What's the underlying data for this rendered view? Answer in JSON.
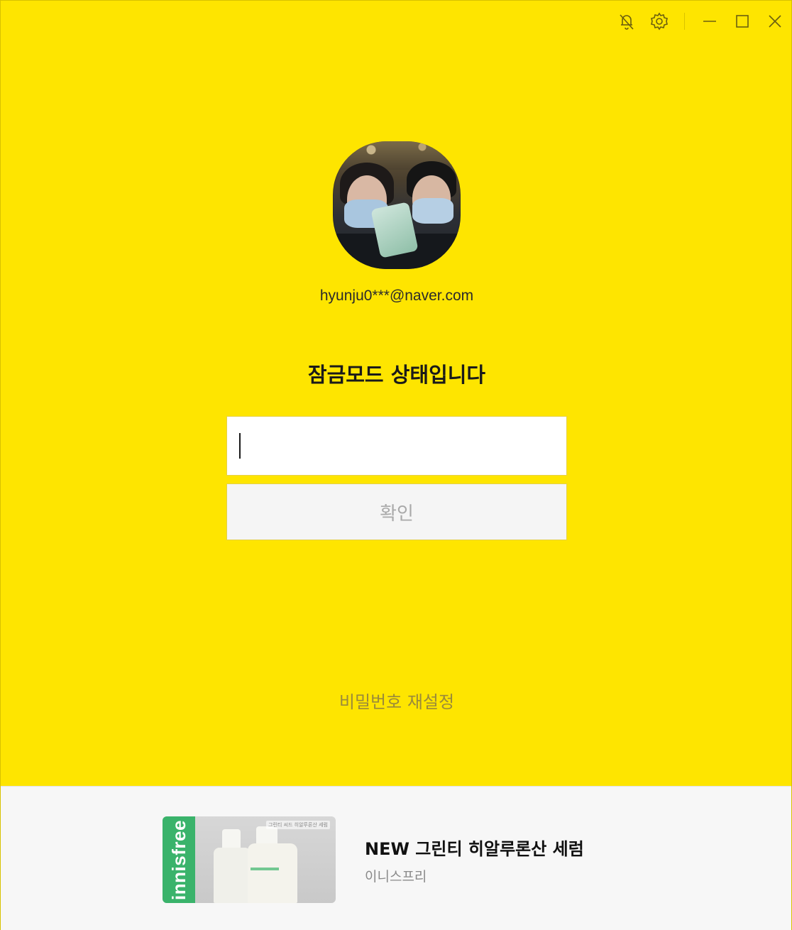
{
  "window": {
    "controls": {
      "notification_icon": "bell-off-icon",
      "settings_icon": "gear-icon",
      "minimize_icon": "minimize-icon",
      "maximize_icon": "maximize-icon",
      "close_icon": "close-icon"
    },
    "background_color": "#FEE500"
  },
  "lock_screen": {
    "account_email": "hyunju0***@naver.com",
    "title": "잠금모드 상태입니다",
    "password_input": {
      "value": "",
      "placeholder": ""
    },
    "confirm_button": "확인",
    "reset_link": "비밀번호 재설정"
  },
  "ad": {
    "brand_text": "innisfree",
    "tag": "그린티 씨드 히알루론산 세럼",
    "title": "NEW 그린티 히알루론산 세럼",
    "advertiser": "이니스프리",
    "brand_color": "#3AB36B"
  }
}
